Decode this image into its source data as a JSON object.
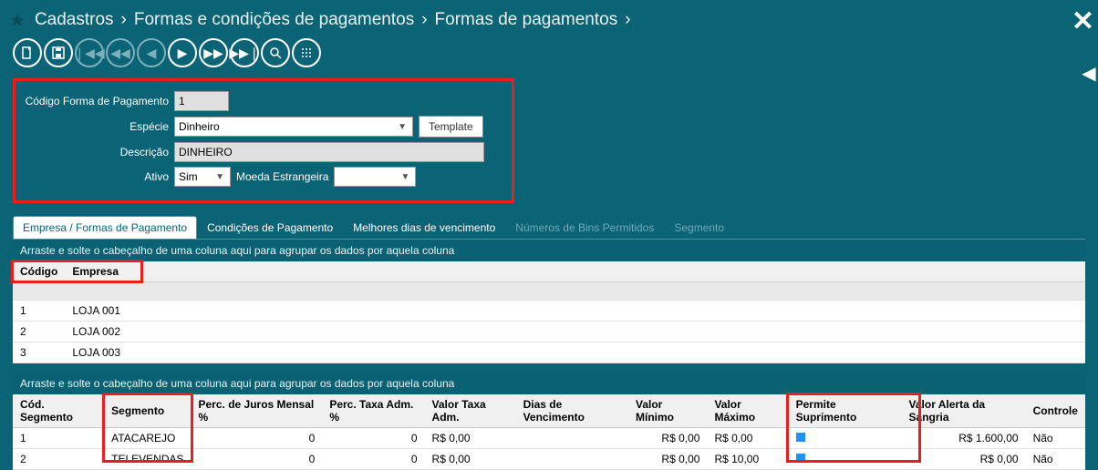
{
  "breadcrumb": {
    "l1": "Cadastros",
    "l2": "Formas e condições de pagamentos",
    "l3": "Formas de pagamentos"
  },
  "form": {
    "codigo_label": "Código Forma de Pagamento",
    "codigo_value": "1",
    "especie_label": "Espécie",
    "especie_value": "Dinheiro",
    "template_button": "Template",
    "descricao_label": "Descrição",
    "descricao_value": "DINHEIRO",
    "ativo_label": "Ativo",
    "ativo_value": "Sim",
    "moeda_label": "Moeda Estrangeira",
    "moeda_value": ""
  },
  "tabs": {
    "t1": "Empresa / Formas de Pagamento",
    "t2": "Condições de Pagamento",
    "t3": "Melhores dias de vencimento",
    "t4": "Números de Bins Permitidos",
    "t5": "Segmento"
  },
  "grid1": {
    "hint": "Arraste e solte o cabeçalho de uma coluna aqui para agrupar os dados por aquela coluna",
    "col1": "Código",
    "col2": "Empresa",
    "rows": [
      {
        "c": "1",
        "e": "LOJA 001"
      },
      {
        "c": "2",
        "e": "LOJA 002"
      },
      {
        "c": "3",
        "e": "LOJA 003"
      }
    ]
  },
  "grid2": {
    "hint": "Arraste e solte o cabeçalho de uma coluna aqui para agrupar os dados por aquela coluna",
    "cols": {
      "c1": "Cód. Segmento",
      "c2": "Segmento",
      "c3": "Perc. de Juros Mensal %",
      "c4": "Perc. Taxa Adm. %",
      "c5": "Valor Taxa Adm.",
      "c6": "Dias de Vencimento",
      "c7": "Valor Mínimo",
      "c8": "Valor Máximo",
      "c9": "Permite Suprimento",
      "c10": "Valor Alerta da Sangria",
      "c11": "Controle"
    },
    "rows": [
      {
        "c1": "1",
        "c2": "ATACAREJO",
        "c3": "0",
        "c4": "0",
        "c5": "R$ 0,00",
        "c6": "",
        "c7": "R$ 0,00",
        "c8": "R$ 0,00",
        "c10": "R$ 1.600,00",
        "c11": "Não"
      },
      {
        "c1": "2",
        "c2": "TELEVENDAS",
        "c3": "0",
        "c4": "0",
        "c5": "R$ 0,00",
        "c6": "",
        "c7": "R$ 0,00",
        "c8": "R$ 10,00",
        "c10": "R$ 0,00",
        "c11": "Não"
      }
    ]
  }
}
